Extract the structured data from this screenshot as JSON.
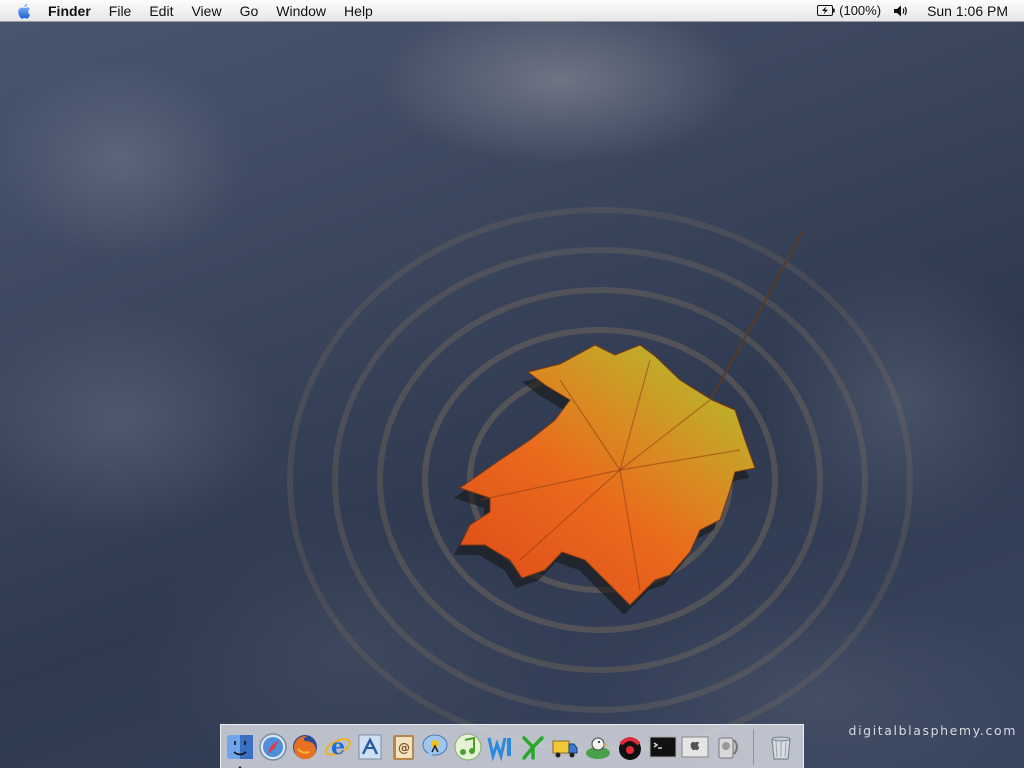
{
  "menubar": {
    "apple_icon": "apple-icon",
    "app_name": "Finder",
    "items": [
      "File",
      "Edit",
      "View",
      "Go",
      "Window",
      "Help"
    ],
    "battery": "(100%)",
    "battery_icon": "battery-charging-icon",
    "volume_icon": "speaker-icon",
    "clock": "Sun 1:06 PM"
  },
  "desktop": {
    "watermark": "digitalblasphemy.com"
  },
  "dock": {
    "apps": [
      {
        "name": "Finder",
        "icon": "finder-icon",
        "running": true
      },
      {
        "name": "Safari",
        "icon": "safari-compass-icon"
      },
      {
        "name": "Firefox",
        "icon": "firefox-icon"
      },
      {
        "name": "Internet Explorer",
        "icon": "internet-explorer-icon"
      },
      {
        "name": "Mail",
        "icon": "mail-stamp-icon"
      },
      {
        "name": "Address Book",
        "icon": "address-book-icon"
      },
      {
        "name": "iChat",
        "icon": "ichat-icon"
      },
      {
        "name": "iTunes",
        "icon": "itunes-icon"
      },
      {
        "name": "Web editor",
        "icon": "web-editor-icon"
      },
      {
        "name": "Network tool",
        "icon": "network-tool-icon"
      },
      {
        "name": "Transmit",
        "icon": "transmit-truck-icon"
      },
      {
        "name": "Cyberduck",
        "icon": "duck-icon"
      },
      {
        "name": "Utility",
        "icon": "utility-icon"
      },
      {
        "name": "Terminal",
        "icon": "terminal-icon"
      },
      {
        "name": "System Preferences",
        "icon": "system-apple-icon"
      },
      {
        "name": "Disk tool",
        "icon": "disk-tool-icon"
      }
    ],
    "trash_icon": "trash-icon"
  },
  "colors": {
    "menubar": "#ececec",
    "leaf_orange": "#e8641c",
    "leaf_yellow": "#b8b02a",
    "water": "#3b465d"
  }
}
